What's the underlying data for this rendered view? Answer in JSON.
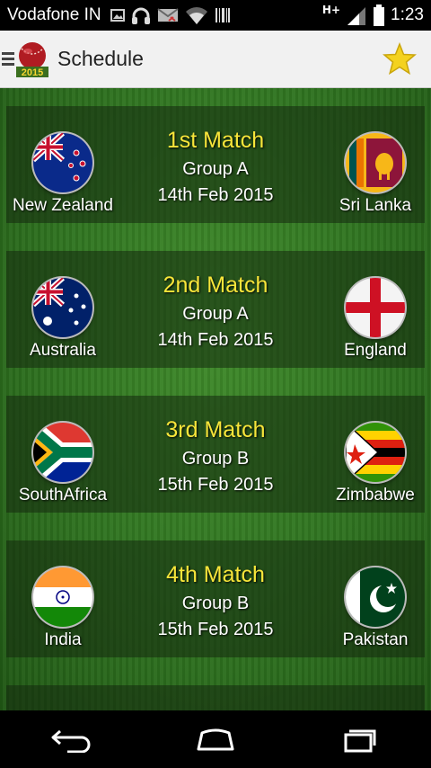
{
  "status_bar": {
    "carrier": "Vodafone IN",
    "network": "H+",
    "time": "1:23",
    "icons": [
      "image-icon",
      "headphones-icon",
      "mail-icon",
      "wifi-icon",
      "barcode-icon",
      "signal-icon",
      "battery-icon"
    ]
  },
  "action_bar": {
    "title": "Schedule",
    "logo_text": "2015",
    "star_color": "#f4d21f"
  },
  "matches": [
    {
      "title": "1st Match",
      "group": "Group A",
      "date": "14th Feb 2015",
      "team1": "New Zealand",
      "team2": "Sri Lanka",
      "flag1": "new-zealand-flag",
      "flag2": "sri-lanka-flag"
    },
    {
      "title": "2nd Match",
      "group": "Group A",
      "date": "14th Feb 2015",
      "team1": "Australia",
      "team2": "England",
      "flag1": "australia-flag",
      "flag2": "england-flag"
    },
    {
      "title": "3rd Match",
      "group": "Group B",
      "date": "15th Feb 2015",
      "team1": "SouthAfrica",
      "team2": "Zimbabwe",
      "flag1": "south-africa-flag",
      "flag2": "zimbabwe-flag"
    },
    {
      "title": "4th Match",
      "group": "Group B",
      "date": "15th Feb 2015",
      "team1": "India",
      "team2": "Pakistan",
      "flag1": "india-flag",
      "flag2": "pakistan-flag"
    }
  ],
  "colors": {
    "match_title": "#f7e53a",
    "text": "#ffffff",
    "grass": "#2f7320"
  },
  "nav_bar": [
    "back-icon",
    "home-icon",
    "recents-icon"
  ]
}
